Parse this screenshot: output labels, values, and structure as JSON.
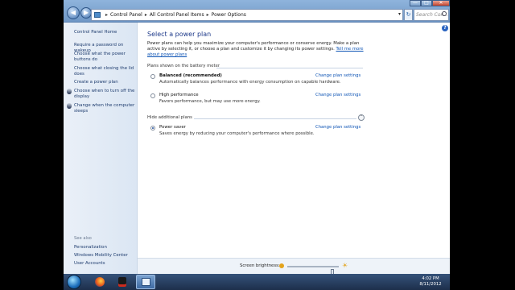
{
  "window": {
    "controls": {
      "minimize": "—",
      "maximize": "□",
      "close": "✕"
    }
  },
  "address_bar": {
    "crumbs": [
      "Control Panel",
      "All Control Panel Items",
      "Power Options"
    ],
    "search_placeholder": "Search Con..."
  },
  "sidebar": {
    "home_link": "Control Panel Home",
    "links": [
      "Require a password on wakeup",
      "Choose what the power buttons do",
      "Choose what closing the lid does",
      "Create a power plan",
      "Choose when to turn off the display",
      "Change when the computer sleeps"
    ],
    "see_also_heading": "See also",
    "see_also": [
      "Personalization",
      "Windows Mobility Center",
      "User Accounts"
    ]
  },
  "main": {
    "title": "Select a power plan",
    "intro": "Power plans can help you maximize your computer's performance or conserve energy. Make a plan active by selecting it, or choose a plan and customize it by changing its power settings.",
    "intro_link": "Tell me more about power plans",
    "battery_group": "Plans shown on the battery meter",
    "hidden_group": "Hide additional plans",
    "plans": [
      {
        "name": "Balanced (recommended)",
        "description": "Automatically balances performance with energy consumption on capable hardware.",
        "link": "Change plan settings",
        "selected": false
      },
      {
        "name": "High performance",
        "description": "Favors performance, but may use more energy.",
        "link": "Change plan settings",
        "selected": false
      },
      {
        "name": "Power saver",
        "description": "Saves energy by reducing your computer's performance where possible.",
        "link": "Change plan settings",
        "selected": true
      }
    ],
    "brightness_label": "Screen brightness:",
    "brightness_level": 0.9
  },
  "taskbar": {
    "time": "4:02 PM",
    "date": "8/11/2012"
  },
  "icons": [
    "back-arrow-icon",
    "forward-arrow-icon",
    "control-panel-icon",
    "refresh-icon",
    "search-icon",
    "help-icon",
    "shield-icon",
    "monitor-icon",
    "windows-start-icon",
    "firefox-icon",
    "gimp-icon",
    "sun-dim-icon",
    "sun-bright-icon"
  ],
  "colors": {
    "link": "#0b52b4",
    "title": "#1e3a8a",
    "sidebar_bg": "#dbe6f3",
    "taskbar": "#1d2f4b"
  }
}
